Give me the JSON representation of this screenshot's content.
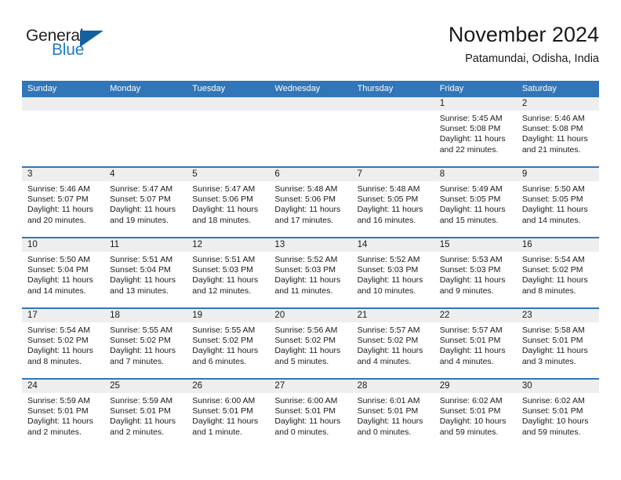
{
  "logo": {
    "word1": "General",
    "word2": "Blue",
    "triangle_color": "#1461a0",
    "blue_text_color": "#1f7cc4",
    "icon": "general-blue-logo"
  },
  "header": {
    "title": "November 2024",
    "subtitle": "Patamundai, Odisha, India"
  },
  "theme": {
    "header_blue": "#3176b8",
    "band_gray": "#eeeeee",
    "text": "#1a1a1a"
  },
  "calendar": {
    "weekday_headers": [
      "Sunday",
      "Monday",
      "Tuesday",
      "Wednesday",
      "Thursday",
      "Friday",
      "Saturday"
    ],
    "weeks": [
      [
        {
          "day": "",
          "sunrise": "",
          "sunset": "",
          "daylight": ""
        },
        {
          "day": "",
          "sunrise": "",
          "sunset": "",
          "daylight": ""
        },
        {
          "day": "",
          "sunrise": "",
          "sunset": "",
          "daylight": ""
        },
        {
          "day": "",
          "sunrise": "",
          "sunset": "",
          "daylight": ""
        },
        {
          "day": "",
          "sunrise": "",
          "sunset": "",
          "daylight": ""
        },
        {
          "day": "1",
          "sunrise": "Sunrise: 5:45 AM",
          "sunset": "Sunset: 5:08 PM",
          "daylight": "Daylight: 11 hours and 22 minutes."
        },
        {
          "day": "2",
          "sunrise": "Sunrise: 5:46 AM",
          "sunset": "Sunset: 5:08 PM",
          "daylight": "Daylight: 11 hours and 21 minutes."
        }
      ],
      [
        {
          "day": "3",
          "sunrise": "Sunrise: 5:46 AM",
          "sunset": "Sunset: 5:07 PM",
          "daylight": "Daylight: 11 hours and 20 minutes."
        },
        {
          "day": "4",
          "sunrise": "Sunrise: 5:47 AM",
          "sunset": "Sunset: 5:07 PM",
          "daylight": "Daylight: 11 hours and 19 minutes."
        },
        {
          "day": "5",
          "sunrise": "Sunrise: 5:47 AM",
          "sunset": "Sunset: 5:06 PM",
          "daylight": "Daylight: 11 hours and 18 minutes."
        },
        {
          "day": "6",
          "sunrise": "Sunrise: 5:48 AM",
          "sunset": "Sunset: 5:06 PM",
          "daylight": "Daylight: 11 hours and 17 minutes."
        },
        {
          "day": "7",
          "sunrise": "Sunrise: 5:48 AM",
          "sunset": "Sunset: 5:05 PM",
          "daylight": "Daylight: 11 hours and 16 minutes."
        },
        {
          "day": "8",
          "sunrise": "Sunrise: 5:49 AM",
          "sunset": "Sunset: 5:05 PM",
          "daylight": "Daylight: 11 hours and 15 minutes."
        },
        {
          "day": "9",
          "sunrise": "Sunrise: 5:50 AM",
          "sunset": "Sunset: 5:05 PM",
          "daylight": "Daylight: 11 hours and 14 minutes."
        }
      ],
      [
        {
          "day": "10",
          "sunrise": "Sunrise: 5:50 AM",
          "sunset": "Sunset: 5:04 PM",
          "daylight": "Daylight: 11 hours and 14 minutes."
        },
        {
          "day": "11",
          "sunrise": "Sunrise: 5:51 AM",
          "sunset": "Sunset: 5:04 PM",
          "daylight": "Daylight: 11 hours and 13 minutes."
        },
        {
          "day": "12",
          "sunrise": "Sunrise: 5:51 AM",
          "sunset": "Sunset: 5:03 PM",
          "daylight": "Daylight: 11 hours and 12 minutes."
        },
        {
          "day": "13",
          "sunrise": "Sunrise: 5:52 AM",
          "sunset": "Sunset: 5:03 PM",
          "daylight": "Daylight: 11 hours and 11 minutes."
        },
        {
          "day": "14",
          "sunrise": "Sunrise: 5:52 AM",
          "sunset": "Sunset: 5:03 PM",
          "daylight": "Daylight: 11 hours and 10 minutes."
        },
        {
          "day": "15",
          "sunrise": "Sunrise: 5:53 AM",
          "sunset": "Sunset: 5:03 PM",
          "daylight": "Daylight: 11 hours and 9 minutes."
        },
        {
          "day": "16",
          "sunrise": "Sunrise: 5:54 AM",
          "sunset": "Sunset: 5:02 PM",
          "daylight": "Daylight: 11 hours and 8 minutes."
        }
      ],
      [
        {
          "day": "17",
          "sunrise": "Sunrise: 5:54 AM",
          "sunset": "Sunset: 5:02 PM",
          "daylight": "Daylight: 11 hours and 8 minutes."
        },
        {
          "day": "18",
          "sunrise": "Sunrise: 5:55 AM",
          "sunset": "Sunset: 5:02 PM",
          "daylight": "Daylight: 11 hours and 7 minutes."
        },
        {
          "day": "19",
          "sunrise": "Sunrise: 5:55 AM",
          "sunset": "Sunset: 5:02 PM",
          "daylight": "Daylight: 11 hours and 6 minutes."
        },
        {
          "day": "20",
          "sunrise": "Sunrise: 5:56 AM",
          "sunset": "Sunset: 5:02 PM",
          "daylight": "Daylight: 11 hours and 5 minutes."
        },
        {
          "day": "21",
          "sunrise": "Sunrise: 5:57 AM",
          "sunset": "Sunset: 5:02 PM",
          "daylight": "Daylight: 11 hours and 4 minutes."
        },
        {
          "day": "22",
          "sunrise": "Sunrise: 5:57 AM",
          "sunset": "Sunset: 5:01 PM",
          "daylight": "Daylight: 11 hours and 4 minutes."
        },
        {
          "day": "23",
          "sunrise": "Sunrise: 5:58 AM",
          "sunset": "Sunset: 5:01 PM",
          "daylight": "Daylight: 11 hours and 3 minutes."
        }
      ],
      [
        {
          "day": "24",
          "sunrise": "Sunrise: 5:59 AM",
          "sunset": "Sunset: 5:01 PM",
          "daylight": "Daylight: 11 hours and 2 minutes."
        },
        {
          "day": "25",
          "sunrise": "Sunrise: 5:59 AM",
          "sunset": "Sunset: 5:01 PM",
          "daylight": "Daylight: 11 hours and 2 minutes."
        },
        {
          "day": "26",
          "sunrise": "Sunrise: 6:00 AM",
          "sunset": "Sunset: 5:01 PM",
          "daylight": "Daylight: 11 hours and 1 minute."
        },
        {
          "day": "27",
          "sunrise": "Sunrise: 6:00 AM",
          "sunset": "Sunset: 5:01 PM",
          "daylight": "Daylight: 11 hours and 0 minutes."
        },
        {
          "day": "28",
          "sunrise": "Sunrise: 6:01 AM",
          "sunset": "Sunset: 5:01 PM",
          "daylight": "Daylight: 11 hours and 0 minutes."
        },
        {
          "day": "29",
          "sunrise": "Sunrise: 6:02 AM",
          "sunset": "Sunset: 5:01 PM",
          "daylight": "Daylight: 10 hours and 59 minutes."
        },
        {
          "day": "30",
          "sunrise": "Sunrise: 6:02 AM",
          "sunset": "Sunset: 5:01 PM",
          "daylight": "Daylight: 10 hours and 59 minutes."
        }
      ]
    ]
  }
}
